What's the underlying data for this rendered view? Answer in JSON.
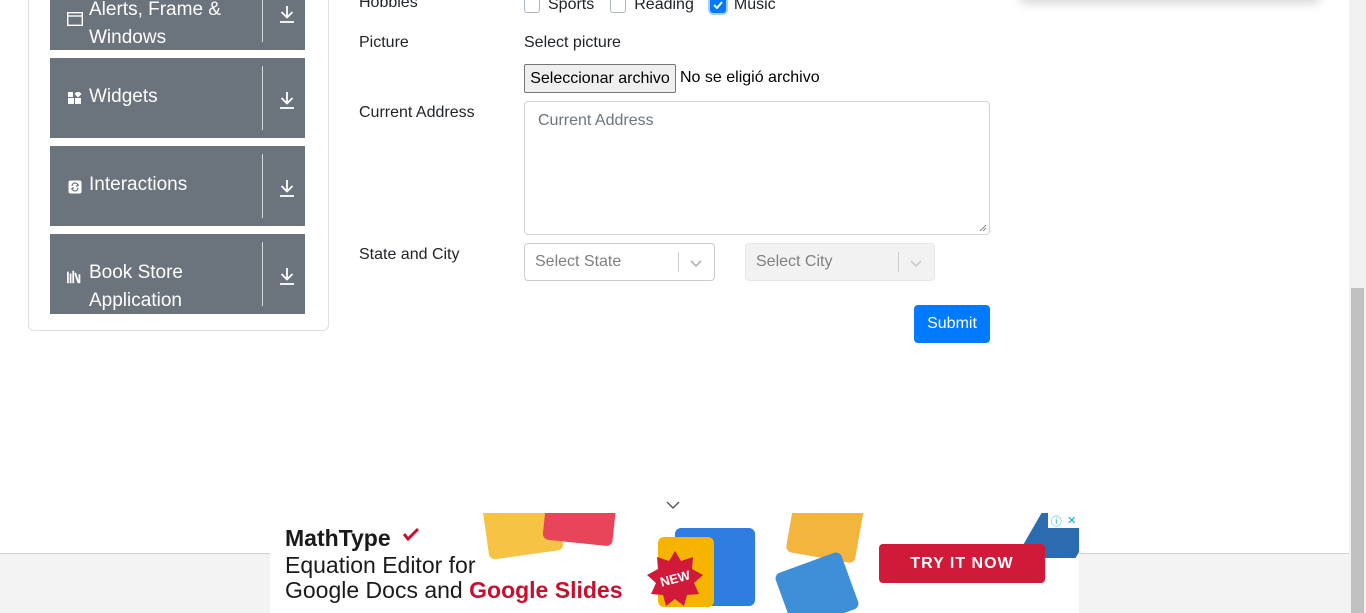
{
  "sidebar": {
    "groups": [
      {
        "label_line1": "Alerts, Frame &",
        "label_line2": "Windows",
        "icon": "window-icon"
      },
      {
        "label_line1": "Widgets",
        "icon": "widgets-icon"
      },
      {
        "label_line1": "Interactions",
        "icon": "interactions-icon"
      },
      {
        "label_line1": "Book Store",
        "label_line2": "Application",
        "icon": "book-icon"
      }
    ],
    "group_color": "#6b737c"
  },
  "form": {
    "hobbies_label": "Hobbies",
    "hobbies": [
      {
        "label": "Sports",
        "checked": false
      },
      {
        "label": "Reading",
        "checked": false
      },
      {
        "label": "Music",
        "checked": true
      }
    ],
    "picture_label": "Picture",
    "select_picture": "Select picture",
    "file_button": "Seleccionar archivo",
    "file_status": "No se eligió archivo",
    "address_label": "Current Address",
    "address_placeholder": "Current Address",
    "state_city_label": "State and City",
    "state_placeholder": "Select State",
    "city_placeholder": "Select City",
    "submit_label": "Submit"
  },
  "ad": {
    "brand": "MathType",
    "line1": "Equation Editor for",
    "line2_prefix": "Google Docs and ",
    "line2_highlight": "Google Slides",
    "badge": "NEW",
    "cta": "TRY IT NOW",
    "info_icon": "ⓘ",
    "close_icon": "✕"
  },
  "colors": {
    "primary": "#007bff",
    "ad_red": "#d11a3a"
  }
}
